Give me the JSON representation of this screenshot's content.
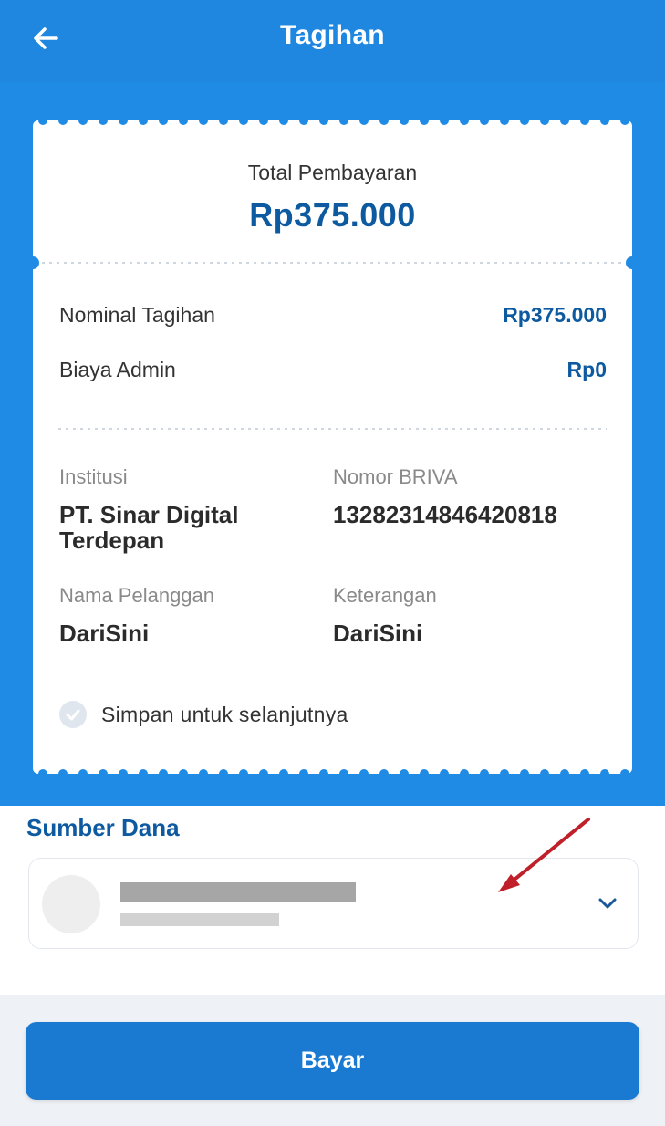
{
  "header": {
    "title": "Tagihan",
    "back_icon": "arrow-left-icon"
  },
  "summary": {
    "label": "Total Pembayaran",
    "amount": "Rp375.000"
  },
  "details": {
    "nominal_label": "Nominal Tagihan",
    "nominal_value": "Rp375.000",
    "admin_label": "Biaya Admin",
    "admin_value": "Rp0"
  },
  "info": {
    "institusi_label": "Institusi",
    "institusi_value": "PT. Sinar Digital Terdepan",
    "briva_label": "Nomor BRIVA",
    "briva_value": "13282314846420818",
    "pelanggan_label": "Nama Pelanggan",
    "pelanggan_value": "DariSini",
    "keterangan_label": "Keterangan",
    "keterangan_value": "DariSini"
  },
  "save": {
    "label": "Simpan untuk selanjutnya",
    "checked": true
  },
  "source": {
    "title": "Sumber Dana",
    "chevron_icon": "chevron-down-icon"
  },
  "pay": {
    "label": "Bayar"
  },
  "colors": {
    "header": "#1f87e0",
    "accent_text": "#0e5aa0",
    "button": "#1a79d1",
    "annotation_arrow": "#c0202a"
  }
}
